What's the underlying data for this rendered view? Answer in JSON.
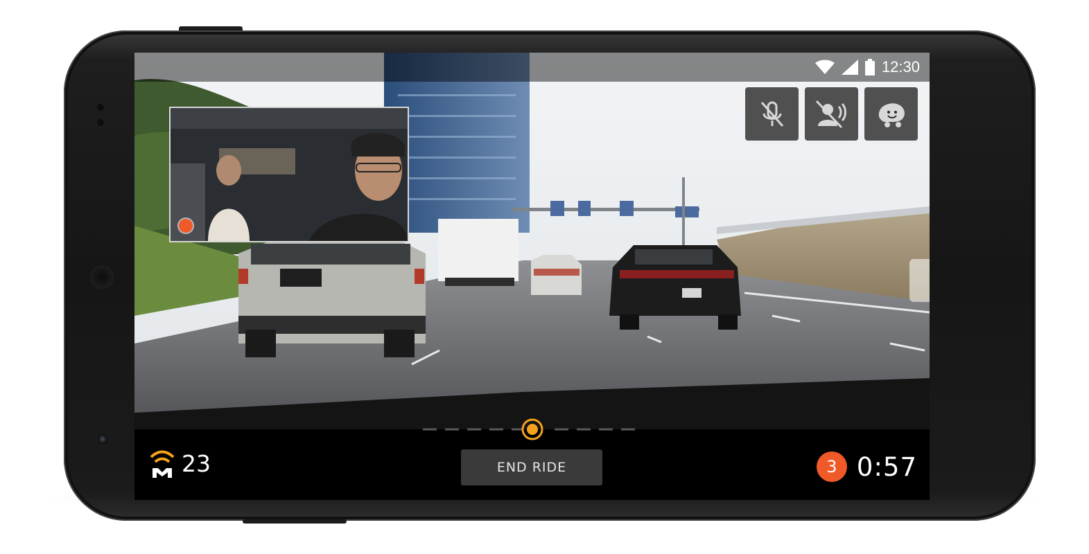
{
  "status_bar": {
    "time": "12:30",
    "icons": [
      "wifi-icon",
      "cell-signal-icon",
      "battery-icon"
    ]
  },
  "controls": [
    {
      "name": "mic-mute-button",
      "icon": "mic-off-icon"
    },
    {
      "name": "voice-mute-button",
      "icon": "speaker-voice-off-icon"
    },
    {
      "name": "waze-button",
      "icon": "waze-icon"
    }
  ],
  "pip": {
    "recording": true
  },
  "bottom": {
    "signal_count": "23",
    "end_ride_label": "END RIDE",
    "badge_count": "3",
    "timer": "0:57"
  },
  "colors": {
    "accent": "#f05a28",
    "progress": "#f4a21e",
    "bar_bg": "#000000"
  }
}
